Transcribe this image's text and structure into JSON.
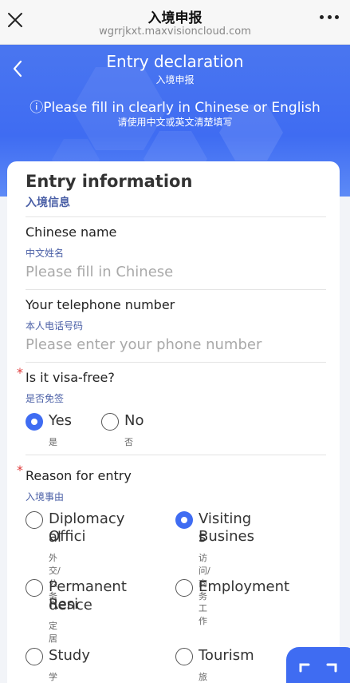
{
  "browser": {
    "title": "入境申报",
    "url": "wgrrjkxt.maxvisioncloud.com"
  },
  "header": {
    "title": "Entry declaration",
    "title_cn": "入境申报",
    "notice": "ⓘPlease fill in clearly in Chinese or English",
    "notice_cn": "请使用中文或英文清楚填写",
    "primary_color": "#3f6cf2"
  },
  "section": {
    "title": "Entry information",
    "title_cn": "入境信息"
  },
  "fields": {
    "chinese_name": {
      "label": "Chinese name",
      "label_cn": "中文姓名",
      "value": "",
      "placeholder": "Please fill in Chinese"
    },
    "phone": {
      "label": "Your telephone number",
      "label_cn": "本人电话号码",
      "value": "",
      "placeholder": "Please enter your phone number"
    },
    "visa_free": {
      "required_mark": "*",
      "label": "Is it visa-free?",
      "label_cn": "是否免签",
      "options": [
        {
          "label": "Yes",
          "label_cn": "是",
          "selected": true
        },
        {
          "label": "No",
          "label_cn": "否",
          "selected": false
        }
      ]
    },
    "reason": {
      "required_mark": "*",
      "label": "Reason for entry",
      "label_cn": "入境事由",
      "options": [
        {
          "line1": "Diplomacy Offici",
          "line2": "al",
          "label_cn": "外交/公务",
          "selected": false
        },
        {
          "line1": "Visiting Busines",
          "line2": "s",
          "label_cn": "访问/商务",
          "selected": true
        },
        {
          "line1": "Permanent Resi",
          "line2": "dence",
          "label_cn": "定居",
          "selected": false
        },
        {
          "line1": "Employment",
          "line2": "",
          "label_cn": "工作",
          "selected": false
        },
        {
          "line1": "Study",
          "line2": "",
          "label_cn": "学习",
          "selected": false
        },
        {
          "line1": "Tourism",
          "line2": "",
          "label_cn": "旅游",
          "selected": false
        }
      ]
    }
  },
  "icons": {
    "close": "close-icon",
    "more": "more-icon",
    "back": "chevron-left-icon",
    "scan": "scan-icon"
  }
}
